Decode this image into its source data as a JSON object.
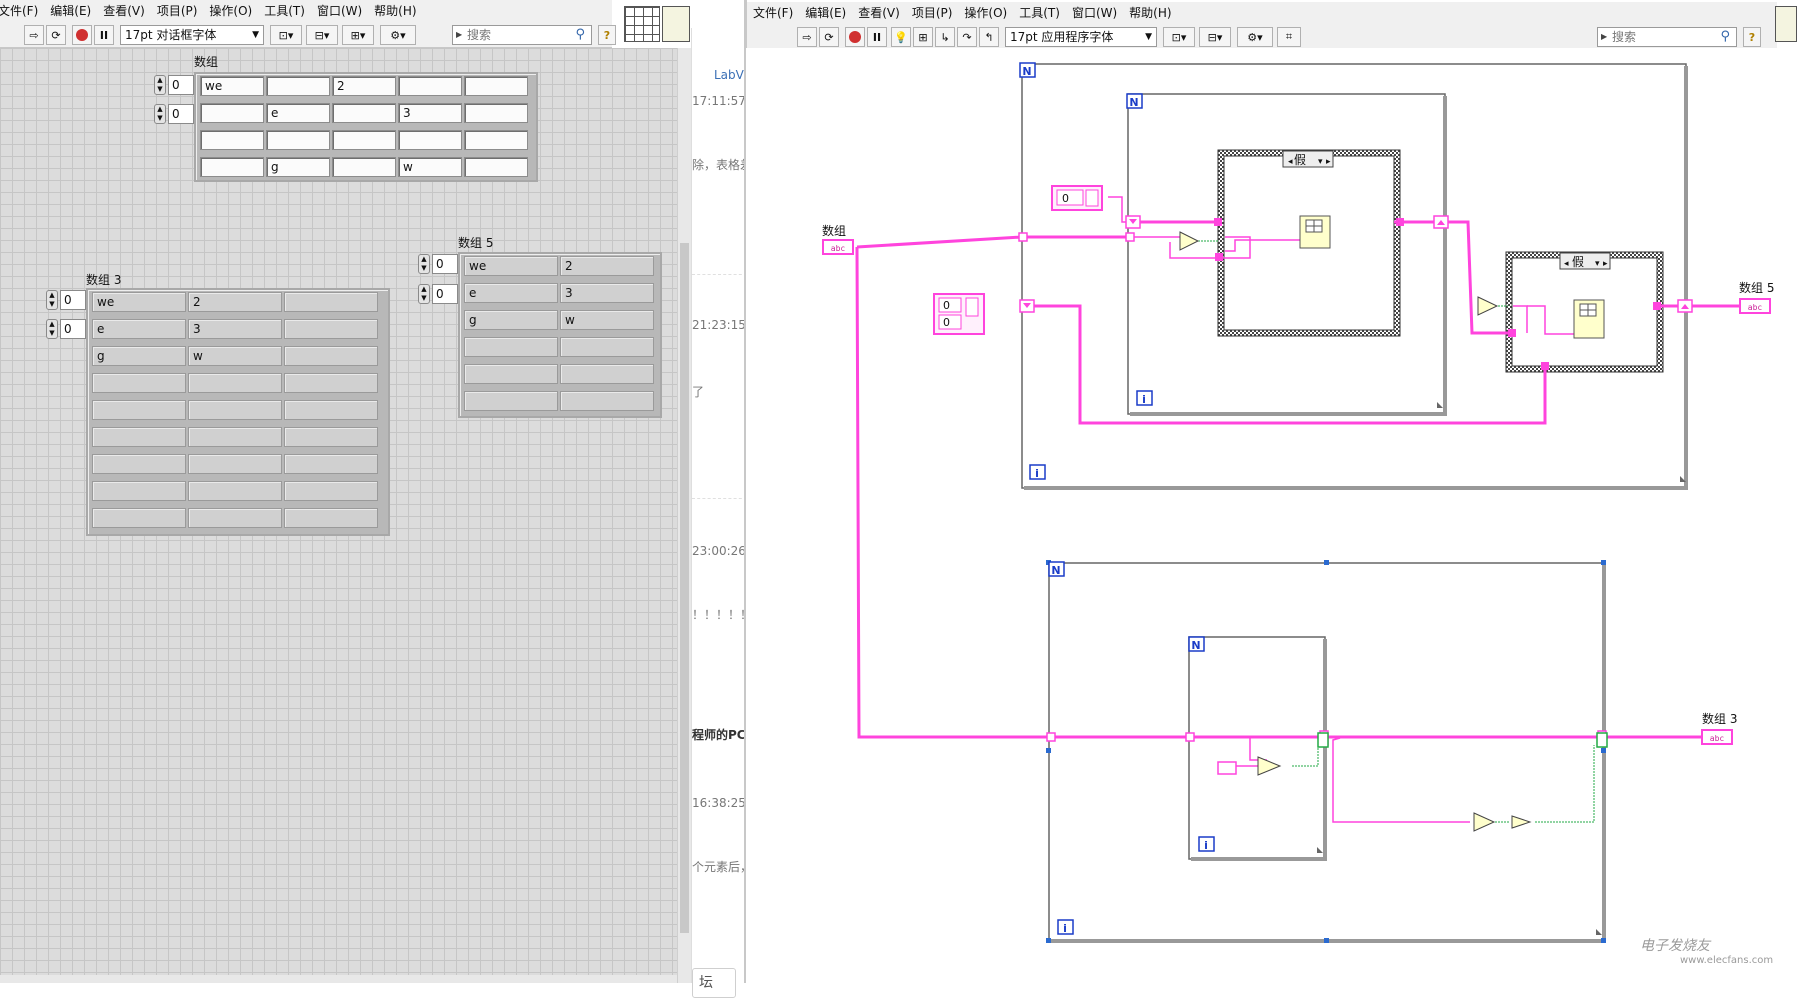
{
  "front_panel": {
    "menu": [
      "文件(F)",
      "编辑(E)",
      "查看(V)",
      "项目(P)",
      "操作(O)",
      "工具(T)",
      "窗口(W)",
      "帮助(H)"
    ],
    "font_select": "17pt 对话框字体",
    "search_placeholder": "搜索",
    "help_icon_text": "?",
    "arrays": {
      "a1": {
        "label": "数组",
        "index0": "0",
        "index1": "0",
        "rows": [
          [
            "we",
            "",
            "2",
            "",
            ""
          ],
          [
            "",
            "e",
            "",
            "3",
            ""
          ],
          [
            "",
            "",
            "",
            "",
            ""
          ],
          [
            "",
            "g",
            "",
            "w",
            ""
          ]
        ]
      },
      "a3": {
        "label": "数组 3",
        "index0": "0",
        "index1": "0",
        "rows": [
          [
            "we",
            "2",
            ""
          ],
          [
            "e",
            "3",
            ""
          ],
          [
            "g",
            "w",
            ""
          ],
          [
            "",
            "",
            ""
          ],
          [
            "",
            "",
            ""
          ],
          [
            "",
            "",
            ""
          ],
          [
            "",
            "",
            ""
          ],
          [
            "",
            "",
            ""
          ],
          [
            "",
            "",
            ""
          ]
        ]
      },
      "a5": {
        "label": "数组 5",
        "index0": "0",
        "index1": "0",
        "rows": [
          [
            "we",
            "2"
          ],
          [
            "e",
            "3"
          ],
          [
            "g",
            "w"
          ],
          [
            "",
            ""
          ],
          [
            "",
            ""
          ],
          [
            "",
            ""
          ]
        ]
      }
    }
  },
  "middle": {
    "link": "LabVI",
    "times": [
      "17:11:57",
      "21:23:15",
      "23:00:26",
      "16:38:25"
    ],
    "snippets": [
      "除，表格差",
      "了",
      "！！！！！",
      "程师的PC",
      "个元素后，"
    ],
    "button": "坛"
  },
  "block_diagram": {
    "menu": [
      "文件(F)",
      "编辑(E)",
      "查看(V)",
      "项目(P)",
      "操作(O)",
      "工具(T)",
      "窗口(W)",
      "帮助(H)"
    ],
    "font_select": "17pt 应用程序字体",
    "search_placeholder": "搜索",
    "help_icon_text": "?",
    "labels": {
      "in_array": "数组",
      "out5": "数组 5",
      "out3": "数组 3",
      "terminal_abc": "abc",
      "case1": "假",
      "case2": "假",
      "loop_n": "N",
      "loop_i": "i",
      "const_a": "0",
      "const_b0": "0",
      "const_b1": "0"
    },
    "watermark": "电子发烧友",
    "watermark_url": "www.elecfans.com"
  },
  "colors": {
    "wire_string": "#ff44dd",
    "wire_bool": "#22aa44",
    "loop_blue": "#1a3cc8",
    "frame_gray": "#555555"
  }
}
